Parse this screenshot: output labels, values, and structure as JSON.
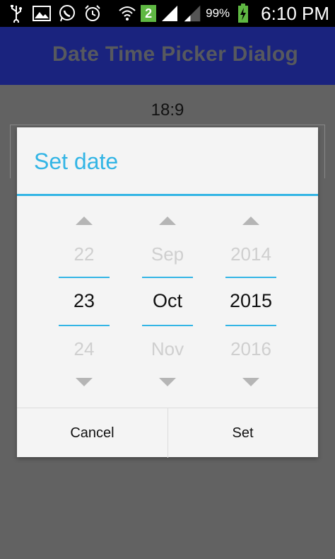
{
  "status_bar": {
    "badge": "2",
    "battery_percent": "99%",
    "time": "6:10 PM"
  },
  "app": {
    "title": "Date Time Picker Dialog",
    "time_display": "18:9"
  },
  "dialog": {
    "title": "Set date",
    "day": {
      "prev": "22",
      "current": "23",
      "next": "24"
    },
    "month": {
      "prev": "Sep",
      "current": "Oct",
      "next": "Nov"
    },
    "year": {
      "prev": "2014",
      "current": "2015",
      "next": "2016"
    },
    "cancel_label": "Cancel",
    "set_label": "Set"
  },
  "colors": {
    "accent": "#33b5e5",
    "action_bar": "#1a237e",
    "dim_background": "#626262"
  }
}
